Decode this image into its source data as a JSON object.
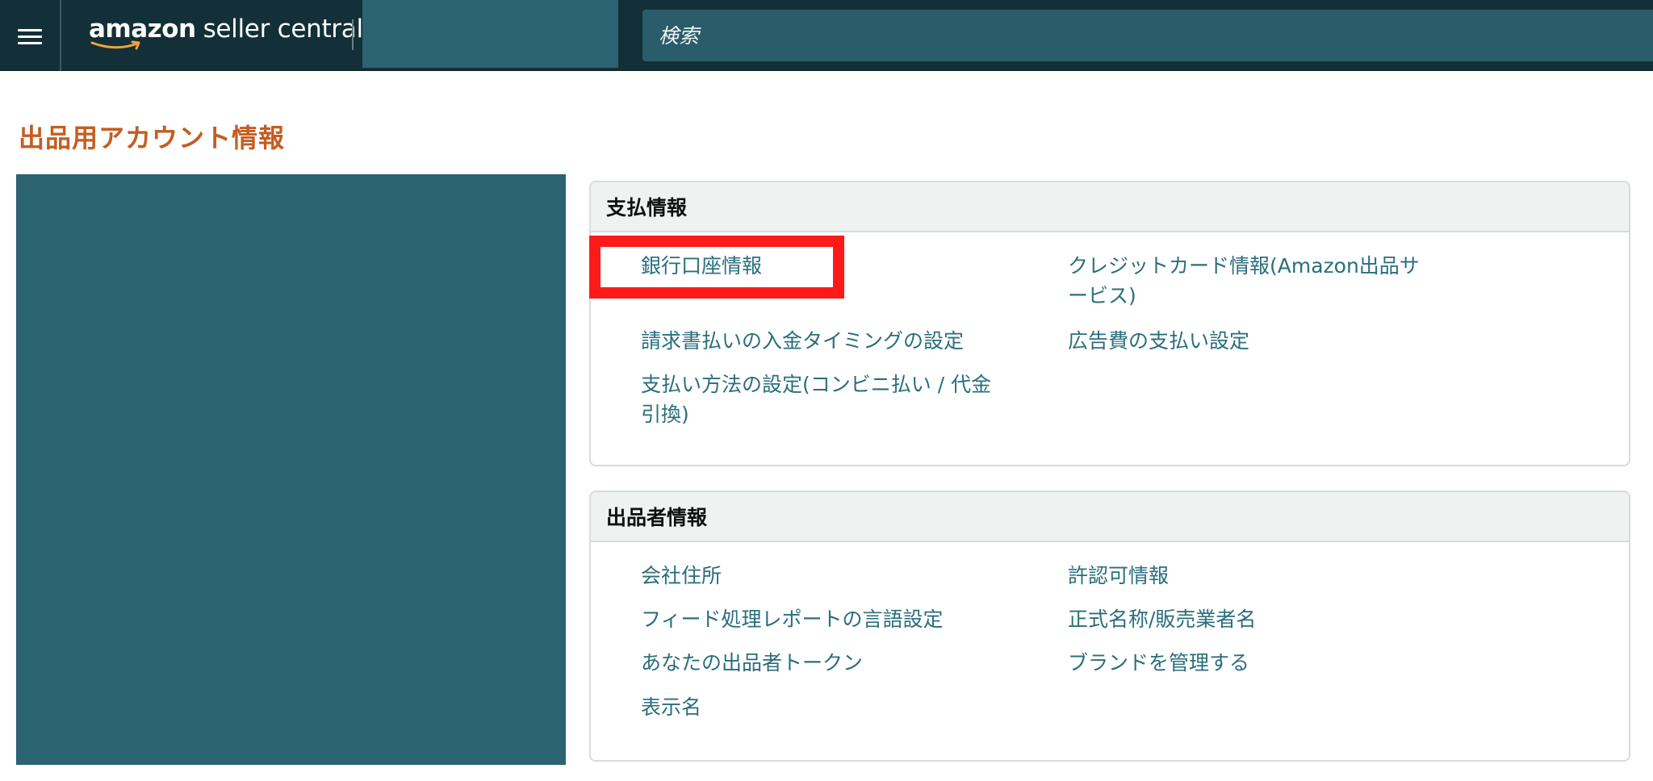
{
  "topbar": {
    "logo_brand": "amazon",
    "logo_suffix": "seller central",
    "search_placeholder": "検索",
    "menu_icon": "hamburger-menu-icon"
  },
  "page": {
    "title": "出品用アカウント情報"
  },
  "payment_section": {
    "title": "支払情報",
    "links": [
      "銀行口座情報",
      "クレジットカード情報(Amazon出品サービス)",
      "請求書払いの入金タイミングの設定",
      "広告費の支払い設定",
      "支払い方法の設定(コンビニ払い / 代金引換)"
    ]
  },
  "seller_section": {
    "title": "出品者情報",
    "links": [
      "会社住所",
      "許認可情報",
      "フィード処理レポートの言語設定",
      "正式名称/販売業者名",
      "あなたの出品者トークン",
      "ブランドを管理する",
      "表示名"
    ]
  },
  "colors": {
    "topbar_bg": "#132f38",
    "accent_teal": "#2c6370",
    "title_orange": "#c45d21",
    "link_teal": "#2a6e7c",
    "highlight_red": "#ff1a1a"
  }
}
